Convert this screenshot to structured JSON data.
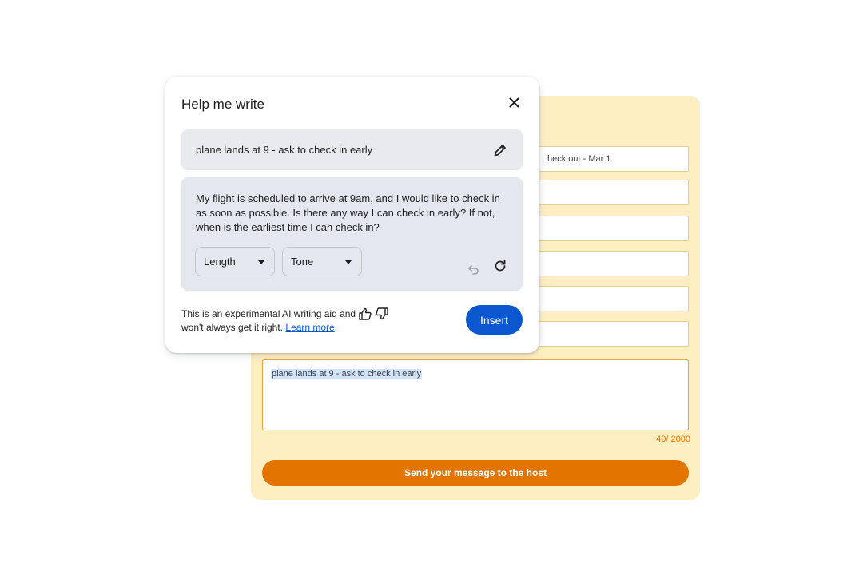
{
  "form": {
    "fields": [
      {
        "value": "heck out - Mar 1"
      },
      {
        "value": ""
      },
      {
        "value": ""
      },
      {
        "value": ""
      },
      {
        "value": ""
      },
      {
        "value": ""
      }
    ],
    "message": "plane lands at 9 - ask to check in early",
    "char_count": "40/ 2000",
    "send_label": "Send your message to the host"
  },
  "dialog": {
    "title": "Help me write",
    "prompt": "plane lands at 9 - ask to check in early",
    "result": "My flight is scheduled to arrive at 9am, and I would like to check in as soon as possible. Is there any way I can check in early? If not, when is the earliest time I can check in?",
    "length_label": "Length",
    "tone_label": "Tone",
    "disclaimer": "This is an experimental AI writing aid and won't always get it right.",
    "learn_more": "Learn more",
    "insert_label": "Insert"
  },
  "icons": {
    "close": "close-icon",
    "edit": "pencil-icon",
    "undo": "undo-icon",
    "refresh": "refresh-icon",
    "thumbs_up": "thumbs-up-icon",
    "thumbs_down": "thumbs-down-icon"
  },
  "colors": {
    "form_background": "#feefc3",
    "accent_orange": "#e37400",
    "insert_blue": "#0b57d0",
    "result_background": "#e3e7ef",
    "prompt_background": "#e8eaed"
  }
}
